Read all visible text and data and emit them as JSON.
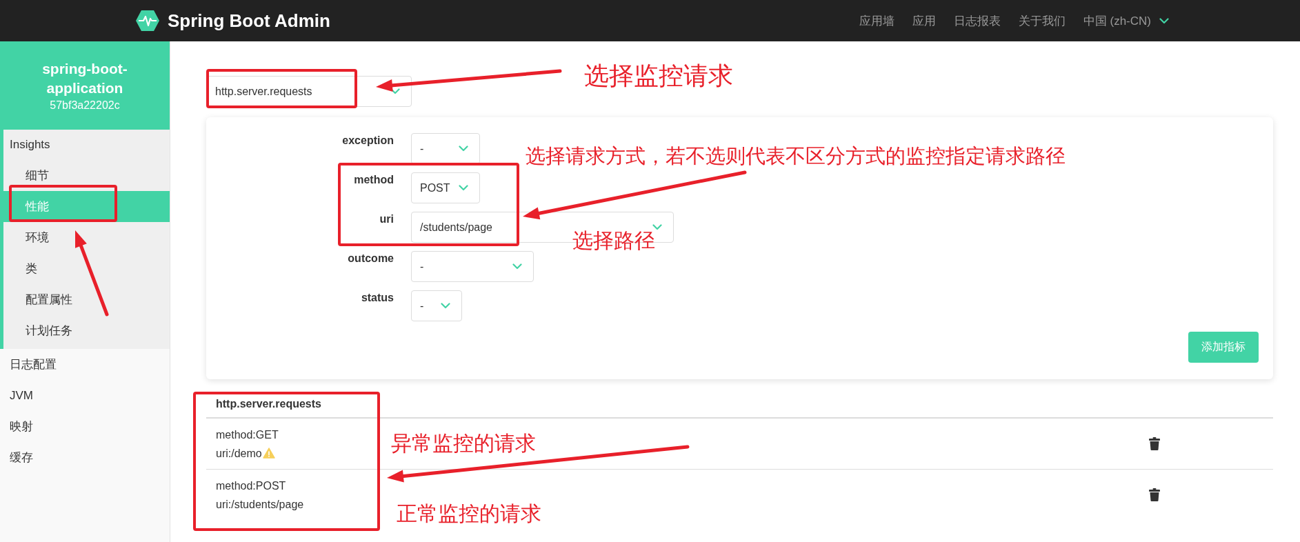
{
  "header": {
    "title": "Spring Boot Admin",
    "nav": [
      "应用墙",
      "应用",
      "日志报表",
      "关于我们"
    ],
    "language": "中国 (zh-CN)"
  },
  "sidebar": {
    "app_name": "spring-boot-application",
    "instance_id": "57bf3a22202c",
    "items": [
      {
        "label": "Insights",
        "selected": false,
        "children": [
          {
            "label": "细节",
            "selected": false
          },
          {
            "label": "性能",
            "selected": true
          },
          {
            "label": "环境",
            "selected": false
          },
          {
            "label": "类",
            "selected": false
          },
          {
            "label": "配置属性",
            "selected": false
          },
          {
            "label": "计划任务",
            "selected": false
          }
        ]
      },
      {
        "label": "日志配置",
        "selected": false
      },
      {
        "label": "JVM",
        "selected": false
      },
      {
        "label": "映射",
        "selected": false
      },
      {
        "label": "缓存",
        "selected": false
      }
    ]
  },
  "metric_select": {
    "value": "http.server.requests"
  },
  "form": {
    "fields": [
      {
        "label": "exception",
        "value": "-"
      },
      {
        "label": "method",
        "value": "POST"
      },
      {
        "label": "uri",
        "value": "/students/page"
      },
      {
        "label": "outcome",
        "value": "-"
      },
      {
        "label": "status",
        "value": "-"
      }
    ],
    "button": "添加指标"
  },
  "table": {
    "title": "http.server.requests",
    "rows": [
      {
        "lines": [
          "method:GET",
          "uri:/demo"
        ],
        "warning": true
      },
      {
        "lines": [
          "method:POST",
          "uri:/students/page"
        ],
        "warning": false
      }
    ]
  },
  "annotations": [
    "选择监控请求",
    "选择请求方式，若不选则代表不区分方式的监控指定请求路径",
    "选择路径",
    "异常监控的请求",
    "正常监控的请求"
  ]
}
